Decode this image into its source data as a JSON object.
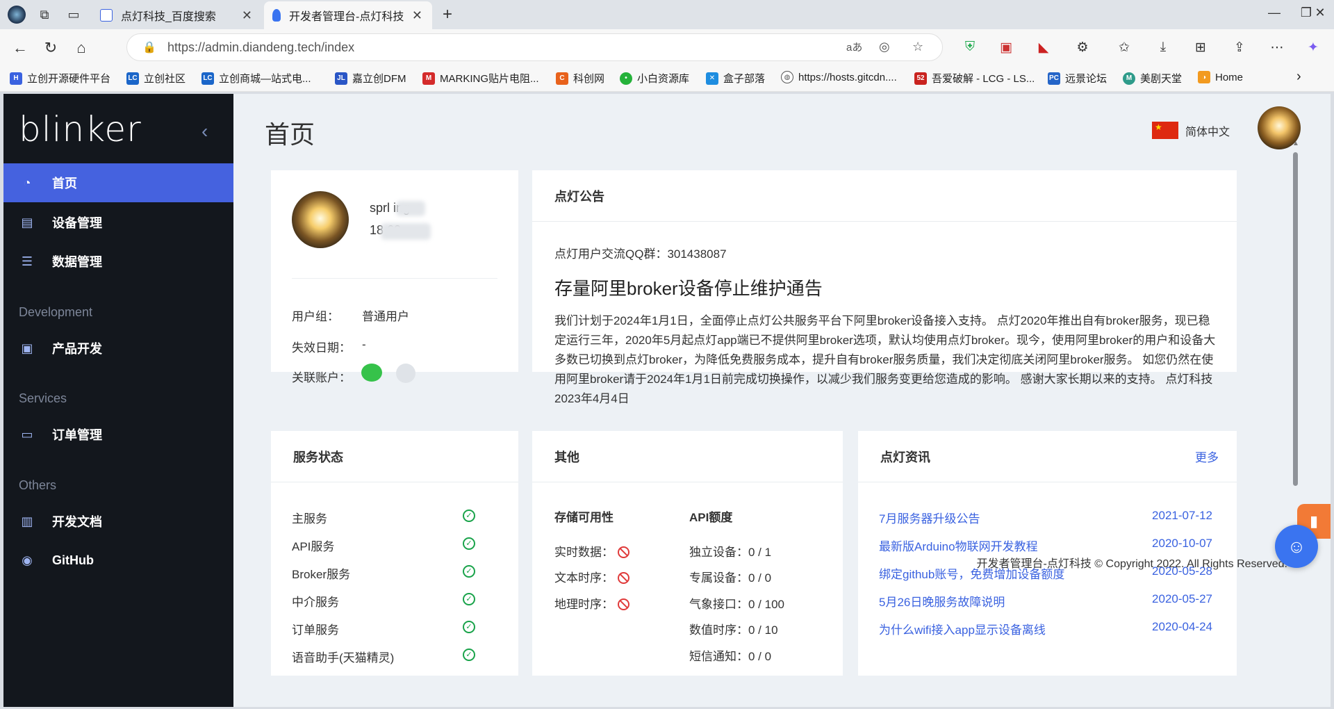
{
  "browser": {
    "tabs": [
      {
        "title": "点灯科技_百度搜索",
        "active": false
      },
      {
        "title": "开发者管理台-点灯科技",
        "active": true
      }
    ],
    "url": "https://admin.diandeng.tech/index",
    "new_tab": "+",
    "reader_label": "aあ",
    "bookmarks": [
      "立创开源硬件平台",
      "立创社区",
      "立创商城—站式电...",
      "嘉立创DFM",
      "MARKING贴片电阻...",
      "科创网",
      "小白资源库",
      "盒子部落",
      "https://hosts.gitcdn....",
      "吾爱破解 - LCG - LS...",
      "远景论坛",
      "美剧天堂",
      "Home"
    ]
  },
  "sidebar": {
    "logo": "blinker",
    "items": [
      {
        "label": "首页",
        "icon": "dashboard-icon"
      },
      {
        "label": "设备管理",
        "icon": "device-icon"
      },
      {
        "label": "数据管理",
        "icon": "database-icon"
      }
    ],
    "groups": [
      {
        "title": "Development",
        "items": [
          {
            "label": "产品开发",
            "icon": "product-icon"
          }
        ]
      },
      {
        "title": "Services",
        "items": [
          {
            "label": "订单管理",
            "icon": "card-icon"
          }
        ]
      },
      {
        "title": "Others",
        "items": [
          {
            "label": "开发文档",
            "icon": "doc-icon"
          },
          {
            "label": "GitHub",
            "icon": "github-icon"
          }
        ]
      }
    ]
  },
  "header": {
    "title": "首页",
    "language": "简体中文"
  },
  "profile": {
    "name": "sprl     ing",
    "phone": "18          60",
    "group_label": "用户组：",
    "group_value": "普通用户",
    "expire_label": "失效日期：",
    "expire_value": "-",
    "linked_label": "关联账户："
  },
  "notice": {
    "title": "点灯公告",
    "qq": "点灯用户交流QQ群：301438087",
    "headline": "存量阿里broker设备停止维护通告",
    "body": "我们计划于2024年1月1日，全面停止点灯公共服务平台下阿里broker设备接入支持。 点灯2020年推出自有broker服务，现已稳定运行三年，2020年5月起点灯app端已不提供阿里broker选项，默认均使用点灯broker。现今，使用阿里broker的用户和设备大多数已切换到点灯broker，为降低免费服务成本，提升自有broker服务质量，我们决定彻底关闭阿里broker服务。 如您仍然在使用阿里broker请于2024年1月1日前完成切换操作，以减少我们服务变更给您造成的影响。 感谢大家长期以来的支持。 点灯科技 2023年4月4日"
  },
  "service_status": {
    "title": "服务状态",
    "items": [
      {
        "name": "主服务",
        "status": "ok"
      },
      {
        "name": "API服务",
        "status": "ok"
      },
      {
        "name": "Broker服务",
        "status": "ok"
      },
      {
        "name": "中介服务",
        "status": "ok"
      },
      {
        "name": "订单服务",
        "status": "ok"
      },
      {
        "name": "语音助手(天猫精灵)",
        "status": "ok"
      }
    ]
  },
  "other": {
    "title": "其他",
    "storage_head": "存储可用性",
    "storage": [
      {
        "label": "实时数据：",
        "available": false
      },
      {
        "label": "文本时序：",
        "available": false
      },
      {
        "label": "地理时序：",
        "available": false
      }
    ],
    "api_head": "API额度",
    "api": [
      "独立设备：0 / 1",
      "专属设备：0 / 0",
      "气象接口：0 / 100",
      "数值时序：0 / 10",
      "短信通知：0 / 0"
    ]
  },
  "news": {
    "title": "点灯资讯",
    "more": "更多",
    "items": [
      {
        "title": "7月服务器升级公告",
        "date": "2021-07-12"
      },
      {
        "title": "最新版Arduino物联网开发教程",
        "date": "2020-10-07"
      },
      {
        "title": "绑定github账号，免费增加设备额度",
        "date": "2020-05-28"
      },
      {
        "title": "5月26日晚服务故障说明",
        "date": "2020-05-27"
      },
      {
        "title": "为什么wifi接入app显示设备离线",
        "date": "2020-04-24"
      }
    ]
  },
  "footer": "开发者管理台-点灯科技 © Copyright 2022. All Rights Reserved.",
  "colors": {
    "accent": "#4562df",
    "sidebar_bg": "#13171d",
    "link": "#3a62e0",
    "ok": "#19a34a",
    "error": "#e03a3a"
  }
}
